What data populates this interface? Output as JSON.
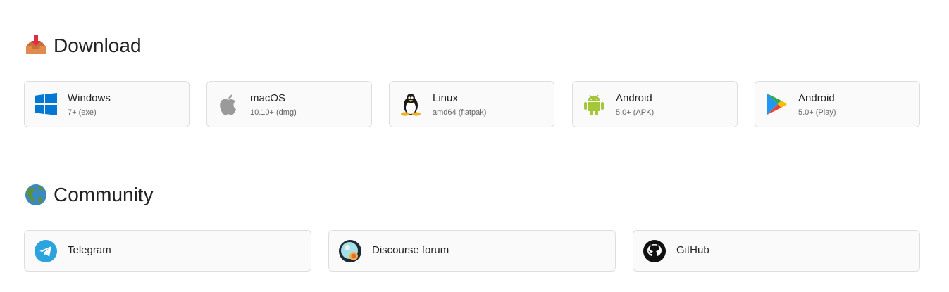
{
  "download": {
    "emoji": "inbox-tray-icon",
    "title": "Download",
    "items": [
      {
        "name": "Windows",
        "sub": "7+ (exe)",
        "icon": "windows-icon"
      },
      {
        "name": "macOS",
        "sub": "10.10+ (dmg)",
        "icon": "apple-icon"
      },
      {
        "name": "Linux",
        "sub": "amd64 (flatpak)",
        "icon": "tux-icon"
      },
      {
        "name": "Android",
        "sub": "5.0+ (APK)",
        "icon": "android-icon"
      },
      {
        "name": "Android",
        "sub": "5.0+ (Play)",
        "icon": "google-play-icon"
      }
    ]
  },
  "community": {
    "emoji": "globe-americas-icon",
    "title": "Community",
    "items": [
      {
        "name": "Telegram",
        "icon": "telegram-icon"
      },
      {
        "name": "Discourse forum",
        "icon": "discourse-icon"
      },
      {
        "name": "GitHub",
        "icon": "github-icon"
      }
    ]
  },
  "colors": {
    "card_bg": "#fafafa",
    "card_border": "#dedede",
    "windows": "#0078d4",
    "android": "#a4c639",
    "telegram": "#2aa3df"
  }
}
